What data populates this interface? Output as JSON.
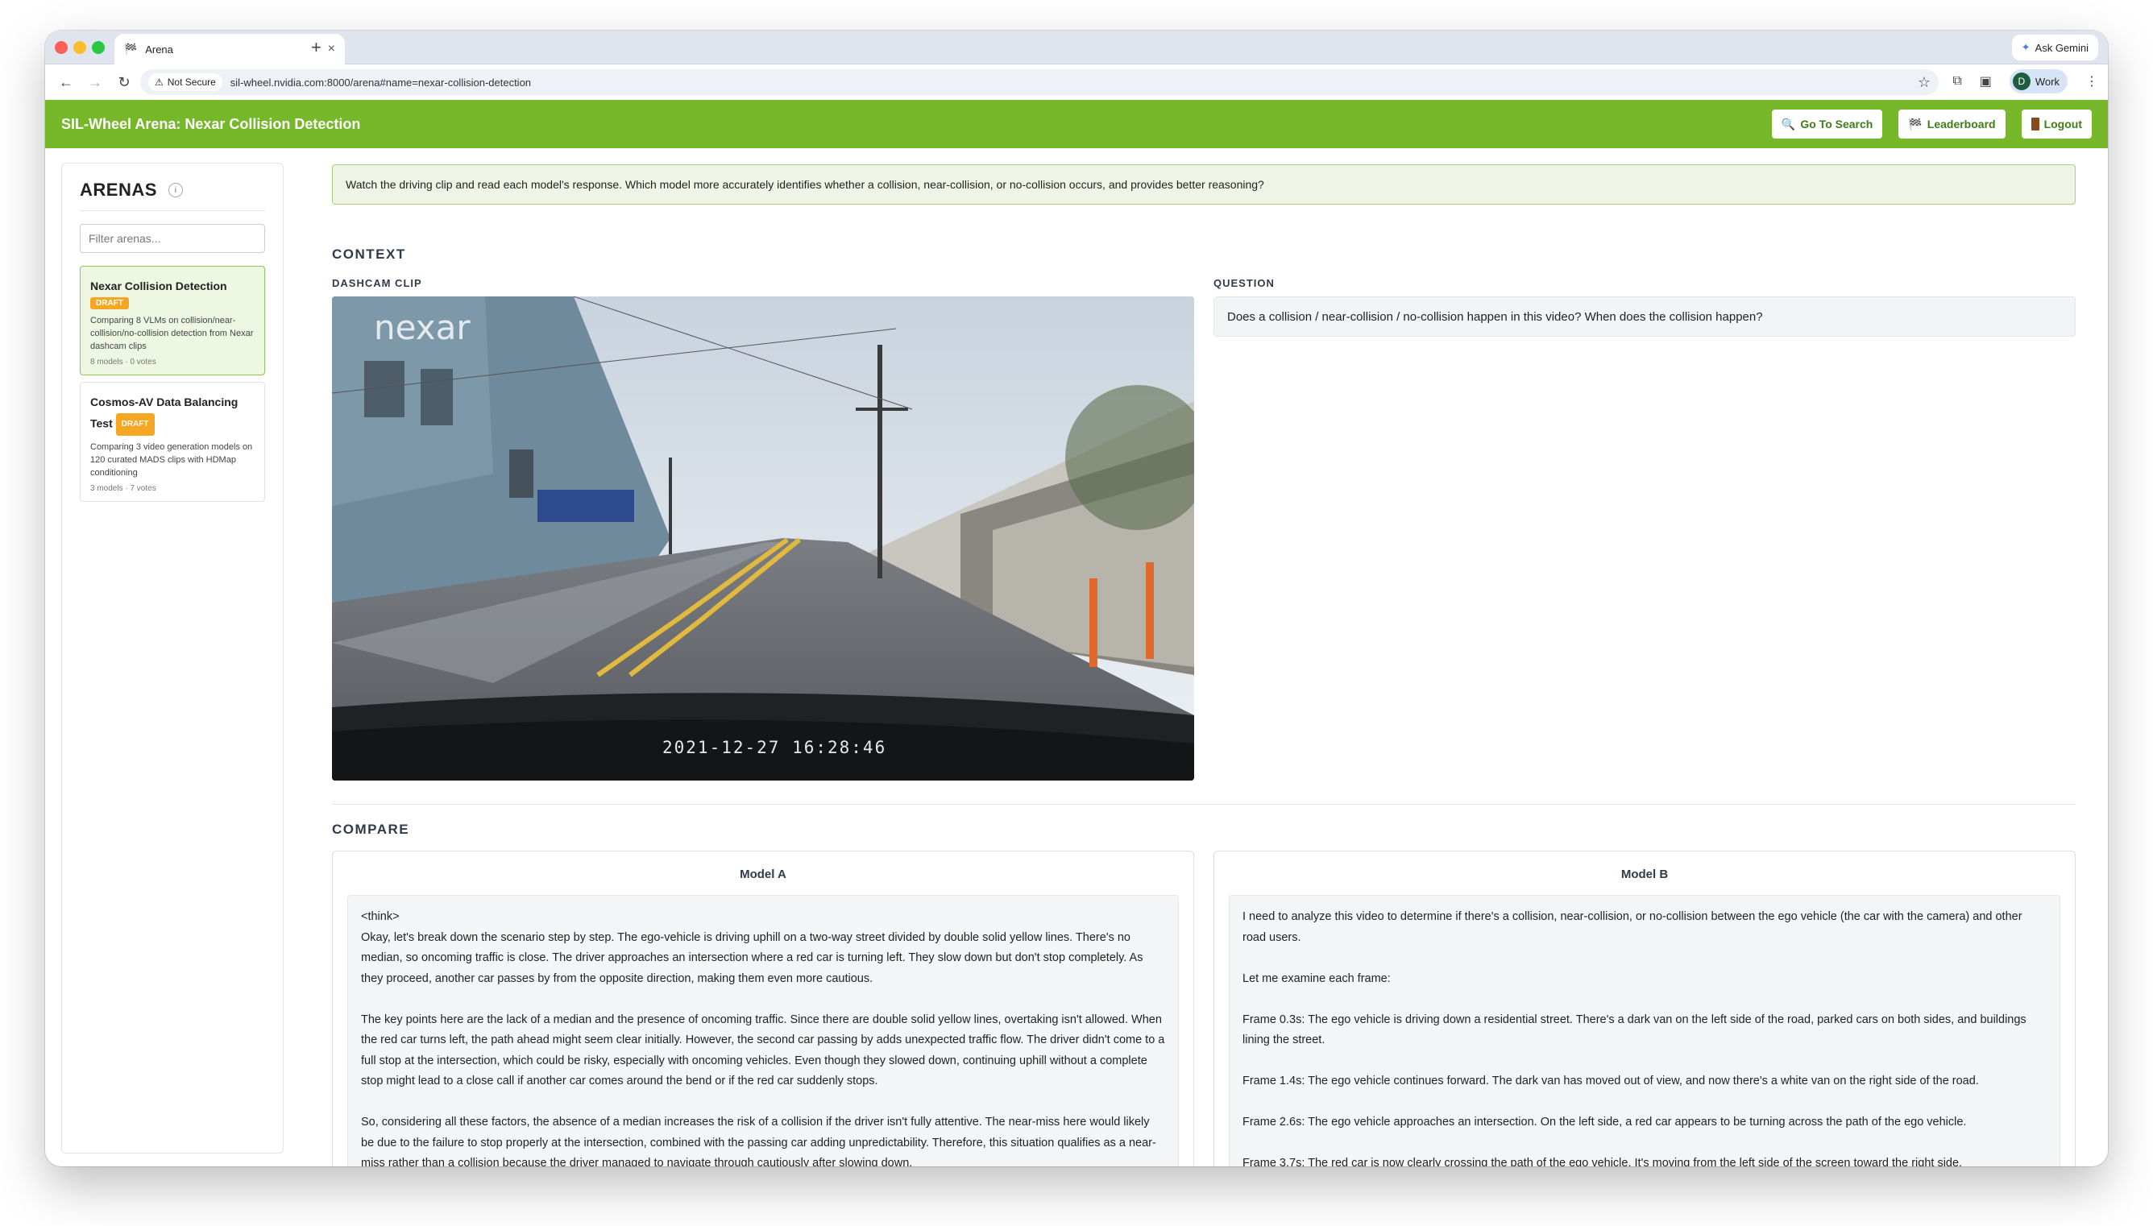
{
  "browser": {
    "tab_title": "Arena",
    "ask_gemini": "Ask Gemini",
    "not_secure": "Not Secure",
    "url": "sil-wheel.nvidia.com:8000/arena#name=nexar-collision-detection",
    "profile_initial": "D",
    "profile_name": "Work"
  },
  "header": {
    "title": "SIL-Wheel Arena: Nexar Collision Detection",
    "go_to_search": "Go To Search",
    "leaderboard": "Leaderboard",
    "logout": "Logout",
    "accent_color": "#76b82a"
  },
  "sidebar": {
    "title": "ARENAS",
    "info": "i",
    "filter_placeholder": "Filter arenas...",
    "arenas": [
      {
        "name": "Nexar Collision Detection",
        "badge": "DRAFT",
        "description": "Comparing 8 VLMs on collision/near-collision/no-collision detection from Nexar dashcam clips",
        "meta": "8 models · 0 votes"
      },
      {
        "name": "Cosmos-AV Data Balancing Test",
        "badge": "DRAFT",
        "description": "Comparing 3 video generation models on 120 curated MADS clips with HDMap conditioning",
        "meta": "3 models · 7 votes"
      }
    ]
  },
  "main": {
    "instruction": "Watch the driving clip and read each model's response. Which model more accurately identifies whether a collision, near-collision, or no-collision occurs, and provides better reasoning?",
    "context_title": "CONTEXT",
    "clip_label": "DASHCAM CLIP",
    "question_label": "QUESTION",
    "question": "Does a collision / near-collision / no-collision happen in this video? When does the collision happen?",
    "video_watermark": "nexar",
    "video_timestamp": "2021-12-27 16:28:46",
    "compare_title": "COMPARE",
    "model_a": {
      "title": "Model A",
      "paragraphs": [
        "<think>\nOkay, let's break down the scenario step by step. The ego-vehicle is driving uphill on a two-way street divided by double solid yellow lines. There's no median, so oncoming traffic is close. The driver approaches an intersection where a red car is turning left. They slow down but don't stop completely. As they proceed, another car passes by from the opposite direction, making them even more cautious.",
        "The key points here are the lack of a median and the presence of oncoming traffic. Since there are double solid yellow lines, overtaking isn't allowed. When the red car turns left, the path ahead might seem clear initially. However, the second car passing by adds unexpected traffic flow. The driver didn't come to a full stop at the intersection, which could be risky, especially with oncoming vehicles. Even though they slowed down, continuing uphill without a complete stop might lead to a close call if another car comes around the bend or if the red car suddenly stops.",
        "So, considering all these factors, the absence of a median increases the risk of a collision if the driver isn't fully attentive. The near-miss here would likely be due to the failure to stop properly at the intersection, combined with the passing car adding unpredictability. Therefore, this situation qualifies as a near-miss rather than a collision because the driver managed to navigate through cautiously after slowing down."
      ]
    },
    "model_b": {
      "title": "Model B",
      "paragraphs": [
        "I need to analyze this video to determine if there's a collision, near-collision, or no-collision between the ego vehicle (the car with the camera) and other road users.",
        "Let me examine each frame:",
        "Frame 0.3s: The ego vehicle is driving down a residential street. There's a dark van on the left side of the road, parked cars on both sides, and buildings lining the street.",
        "Frame 1.4s: The ego vehicle continues forward. The dark van has moved out of view, and now there's a white van on the right side of the road.",
        "Frame 2.6s: The ego vehicle approaches an intersection. On the left side, a red car appears to be turning across the path of the ego vehicle.",
        "Frame 3.7s: The red car is now clearly crossing the path of the ego vehicle. It's moving from the left side of the screen toward the right side,"
      ]
    }
  }
}
